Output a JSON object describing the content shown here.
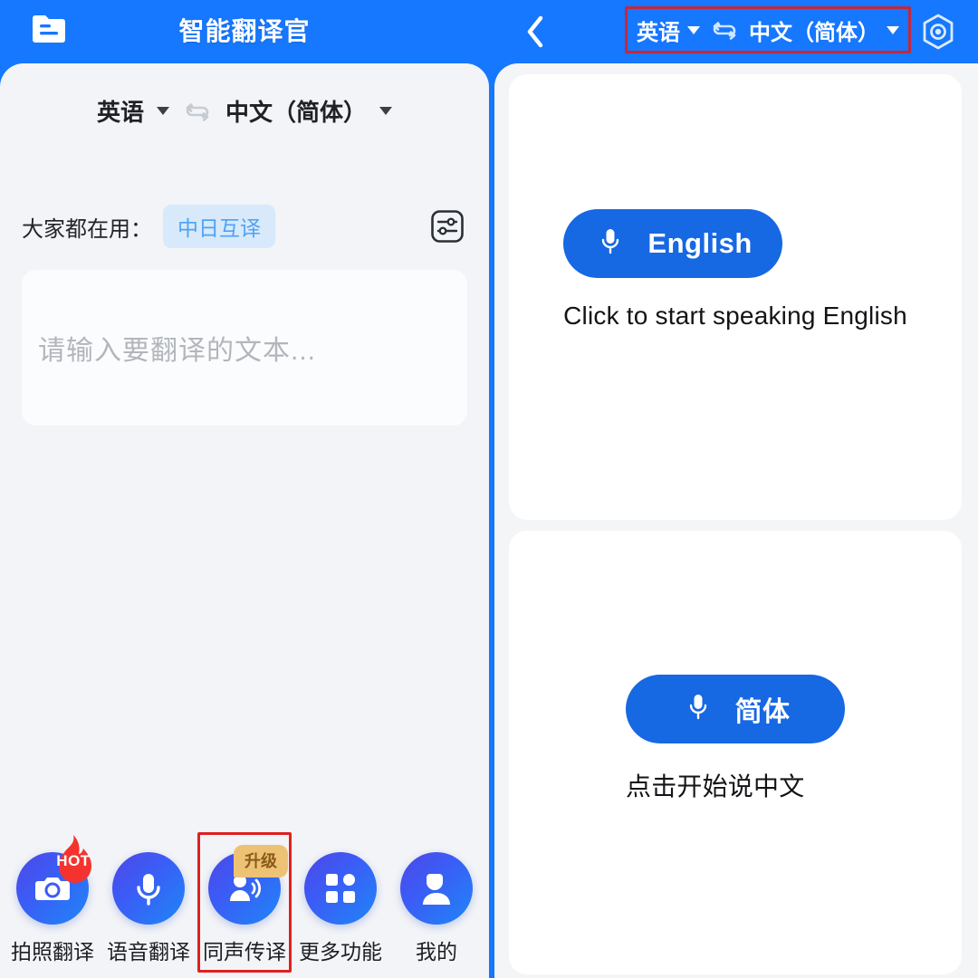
{
  "app": {
    "title": "智能翻译官",
    "accent_blue": "#1677ff",
    "button_blue": "#1668e3",
    "highlight_red": "#e02020",
    "badge_orange": "#eec275",
    "chip_bg": "#d7e9fb",
    "chip_text": "#4da3f5"
  },
  "topbar": {
    "folder_icon": "folder-document-icon",
    "title": "智能翻译官",
    "back_icon": "back-chevron-icon",
    "source_language": "英语",
    "swap_icon": "swap-languages-icon",
    "target_language": "中文（简体）",
    "caret_icon": "chevron-down-icon",
    "gear_icon": "hexagon-settings-icon"
  },
  "left_panel": {
    "language_bar": {
      "source_language": "英语",
      "swap_icon": "swap-languages-icon",
      "target_language": "中文（简体）",
      "caret_icon": "chevron-down-icon"
    },
    "popular": {
      "label": "大家都在用：",
      "chip": "中日互译",
      "settings_icon": "sliders-icon"
    },
    "input": {
      "placeholder": "请输入要翻译的文本...",
      "value": ""
    },
    "nav": [
      {
        "label": "拍照翻译",
        "icon": "camera-icon",
        "badge": "HOT",
        "badge_type": "flame",
        "highlighted": false
      },
      {
        "label": "语音翻译",
        "icon": "microphone-icon",
        "badge": "",
        "badge_type": "",
        "highlighted": false
      },
      {
        "label": "同声传译",
        "icon": "person-speaking-icon",
        "badge": "升级",
        "badge_type": "upgrade",
        "highlighted": true
      },
      {
        "label": "更多功能",
        "icon": "grid-apps-icon",
        "badge": "",
        "badge_type": "",
        "highlighted": false
      },
      {
        "label": "我的",
        "icon": "user-profile-icon",
        "badge": "",
        "badge_type": "",
        "highlighted": false
      }
    ]
  },
  "right_panel": {
    "cards": [
      {
        "mic_icon": "microphone-icon",
        "button_label": "English",
        "hint": "Click to start speaking English"
      },
      {
        "mic_icon": "microphone-icon",
        "button_label": "简体",
        "hint": "点击开始说中文"
      }
    ]
  }
}
